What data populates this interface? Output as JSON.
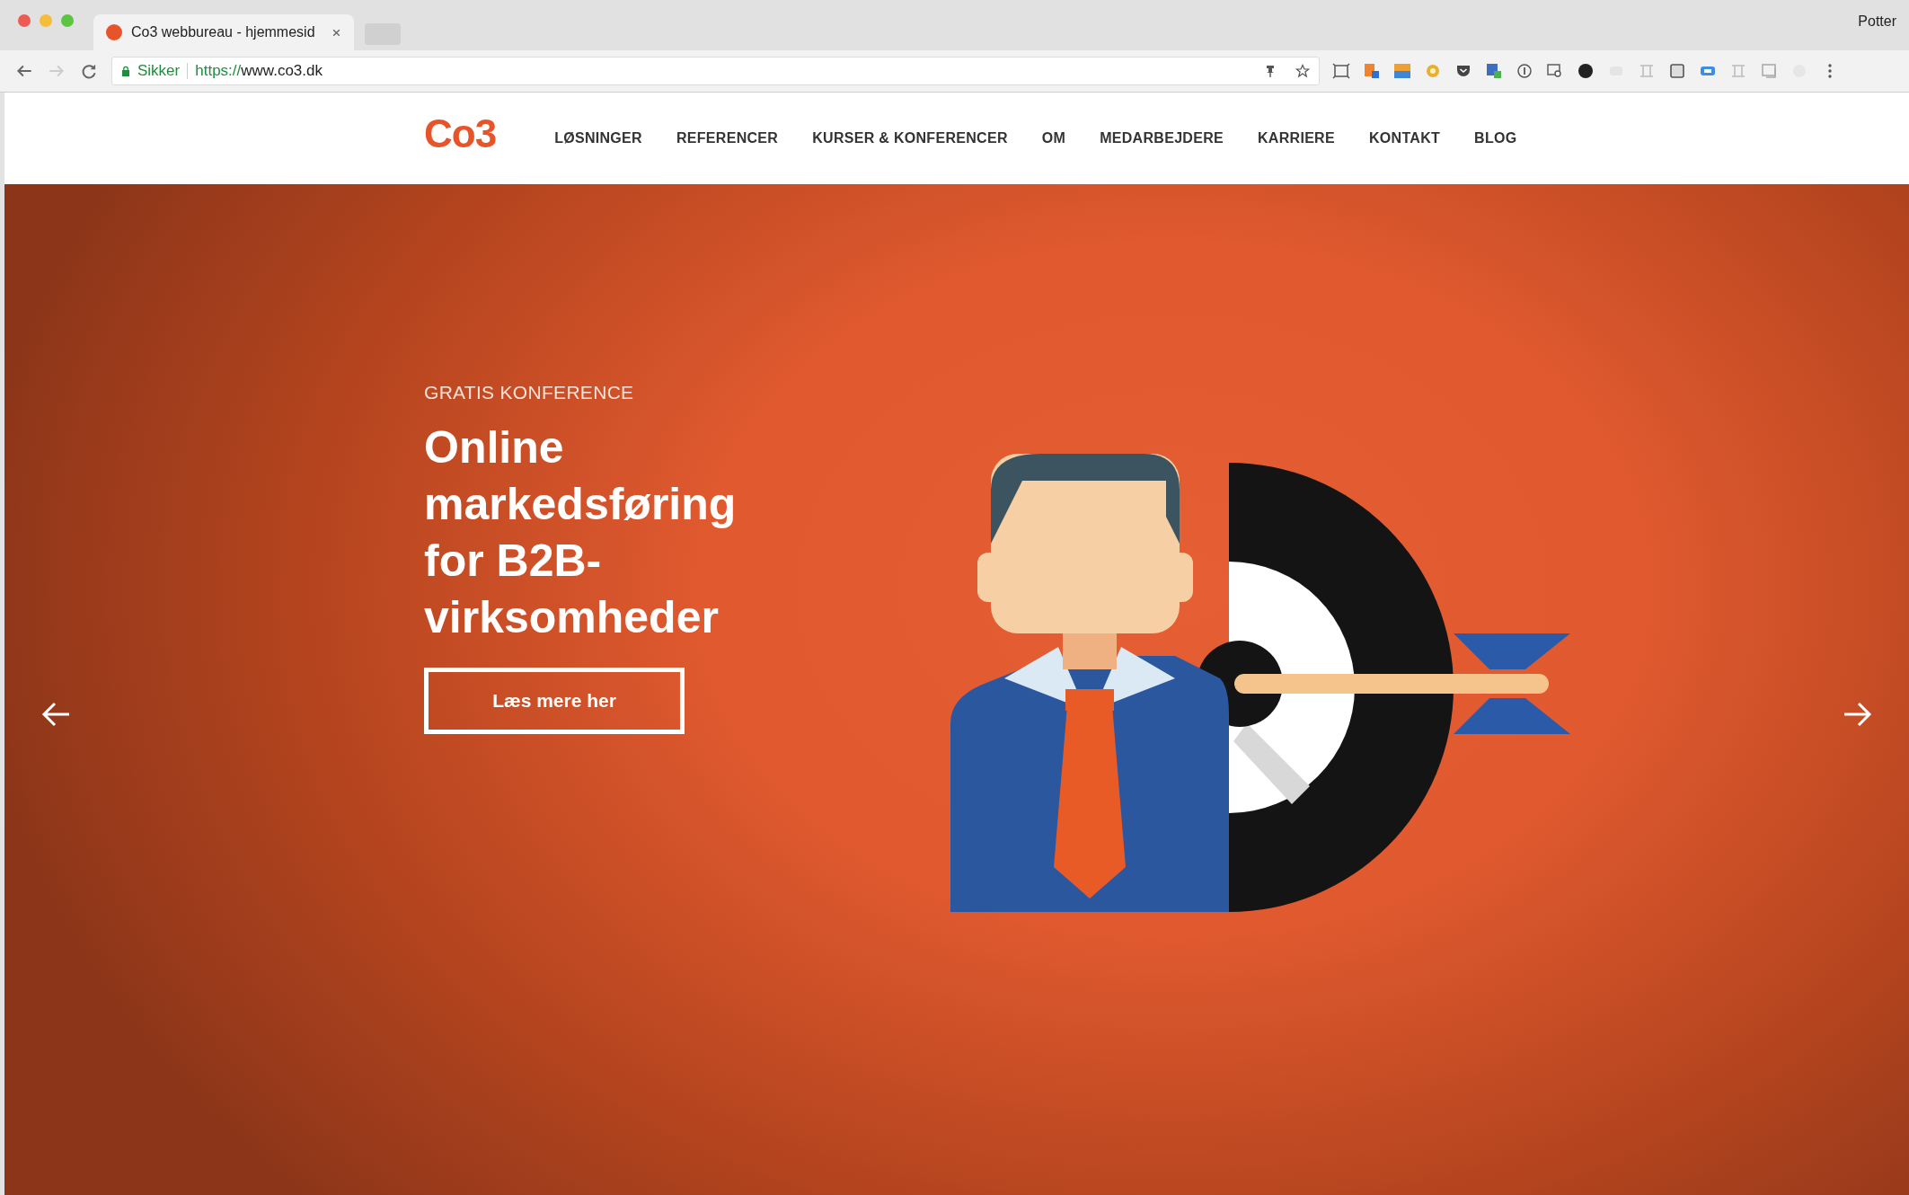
{
  "browser": {
    "tab": {
      "title": "Co3 webbureau - hjemmesid"
    },
    "profile": "Potter",
    "address": {
      "security": "Sikker",
      "scheme": "https://",
      "host": "www.co3.dk"
    }
  },
  "site": {
    "logo": "Co3",
    "nav": [
      {
        "label": "LØSNINGER"
      },
      {
        "label": "REFERENCER"
      },
      {
        "label": "KURSER & KONFERENCER"
      },
      {
        "label": "OM"
      },
      {
        "label": "MEDARBEJDERE"
      },
      {
        "label": "KARRIERE"
      },
      {
        "label": "KONTAKT"
      },
      {
        "label": "BLOG"
      }
    ]
  },
  "hero": {
    "eyebrow": "GRATIS KONFERENCE",
    "heading": "Online markedsføring for B2B-virksomheder",
    "button": "Læs mere her"
  }
}
